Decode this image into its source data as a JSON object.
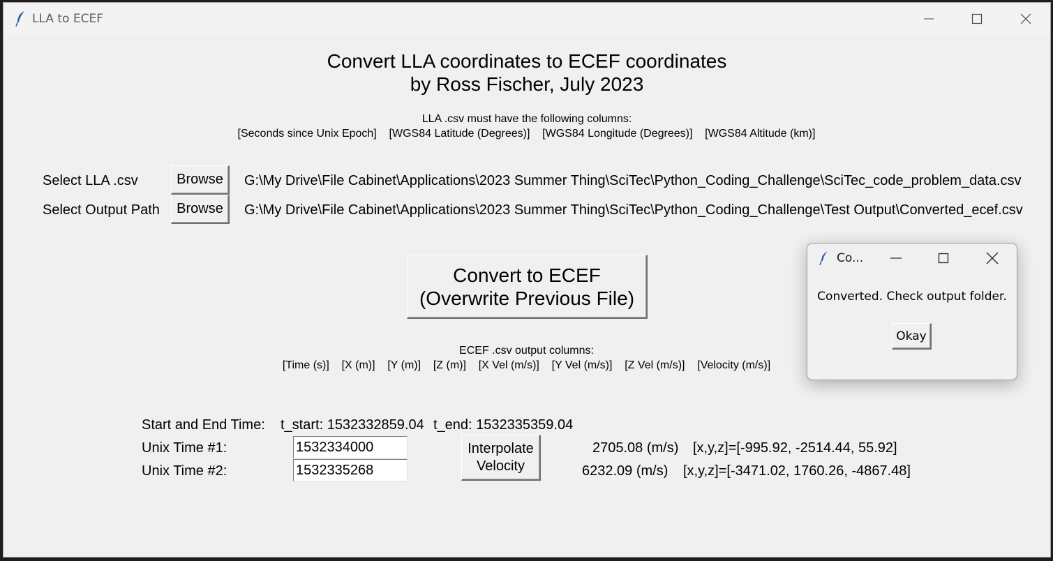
{
  "window": {
    "title": "LLA to ECEF"
  },
  "header": {
    "line1": "Convert LLA coordinates to ECEF coordinates",
    "line2": "by Ross Fischer, July 2023"
  },
  "lla_info": {
    "label": "LLA .csv must have the following columns:",
    "columns": "[Seconds since Unix Epoch]    [WGS84 Latitude (Degrees)]    [WGS84 Longitude (Degrees)]    [WGS84 Altitude (km)]"
  },
  "input_row": {
    "label": "Select LLA .csv",
    "button": "Browse",
    "path": "G:\\My Drive\\File Cabinet\\Applications\\2023 Summer Thing\\SciTec\\Python_Coding_Challenge\\SciTec_code_problem_data.csv"
  },
  "output_row": {
    "label": "Select Output Path",
    "button": "Browse",
    "path": "G:\\My Drive\\File Cabinet\\Applications\\2023 Summer Thing\\SciTec\\Python_Coding_Challenge\\Test Output\\Converted_ecef.csv"
  },
  "convert_button": {
    "line1": "Convert to ECEF",
    "line2": "(Overwrite Previous File)"
  },
  "ecef_info": {
    "label": "ECEF .csv output columns:",
    "columns": "[Time (s)]    [X (m)]    [Y (m)]    [Z (m)]    [X Vel (m/s)]    [Y Vel (m/s)]    [Z Vel (m/s)]    [Velocity (m/s)]"
  },
  "time_range": {
    "label": "Start and End Time:",
    "t_start": "t_start: 1532332859.04",
    "t_end": "t_end: 1532335359.04"
  },
  "unix_time_1": {
    "label": "Unix Time #1:",
    "value": "1532334000",
    "speed": "2705.08 (m/s)",
    "vector": "[x,y,z]=[-995.92, -2514.44, 55.92]"
  },
  "unix_time_2": {
    "label": "Unix Time #2:",
    "value": "1532335268",
    "speed": "6232.09 (m/s)",
    "vector": "[x,y,z]=[-3471.02, 1760.26, -4867.48]"
  },
  "interpolate_button": {
    "line1": "Interpolate",
    "line2": "Velocity"
  },
  "dialog": {
    "title": "Co...",
    "message": "Converted. Check output folder.",
    "ok_button": "Okay"
  },
  "icons": {
    "app": "feather-icon",
    "minimize": "minimize-icon",
    "maximize": "maximize-icon",
    "close": "close-icon"
  }
}
